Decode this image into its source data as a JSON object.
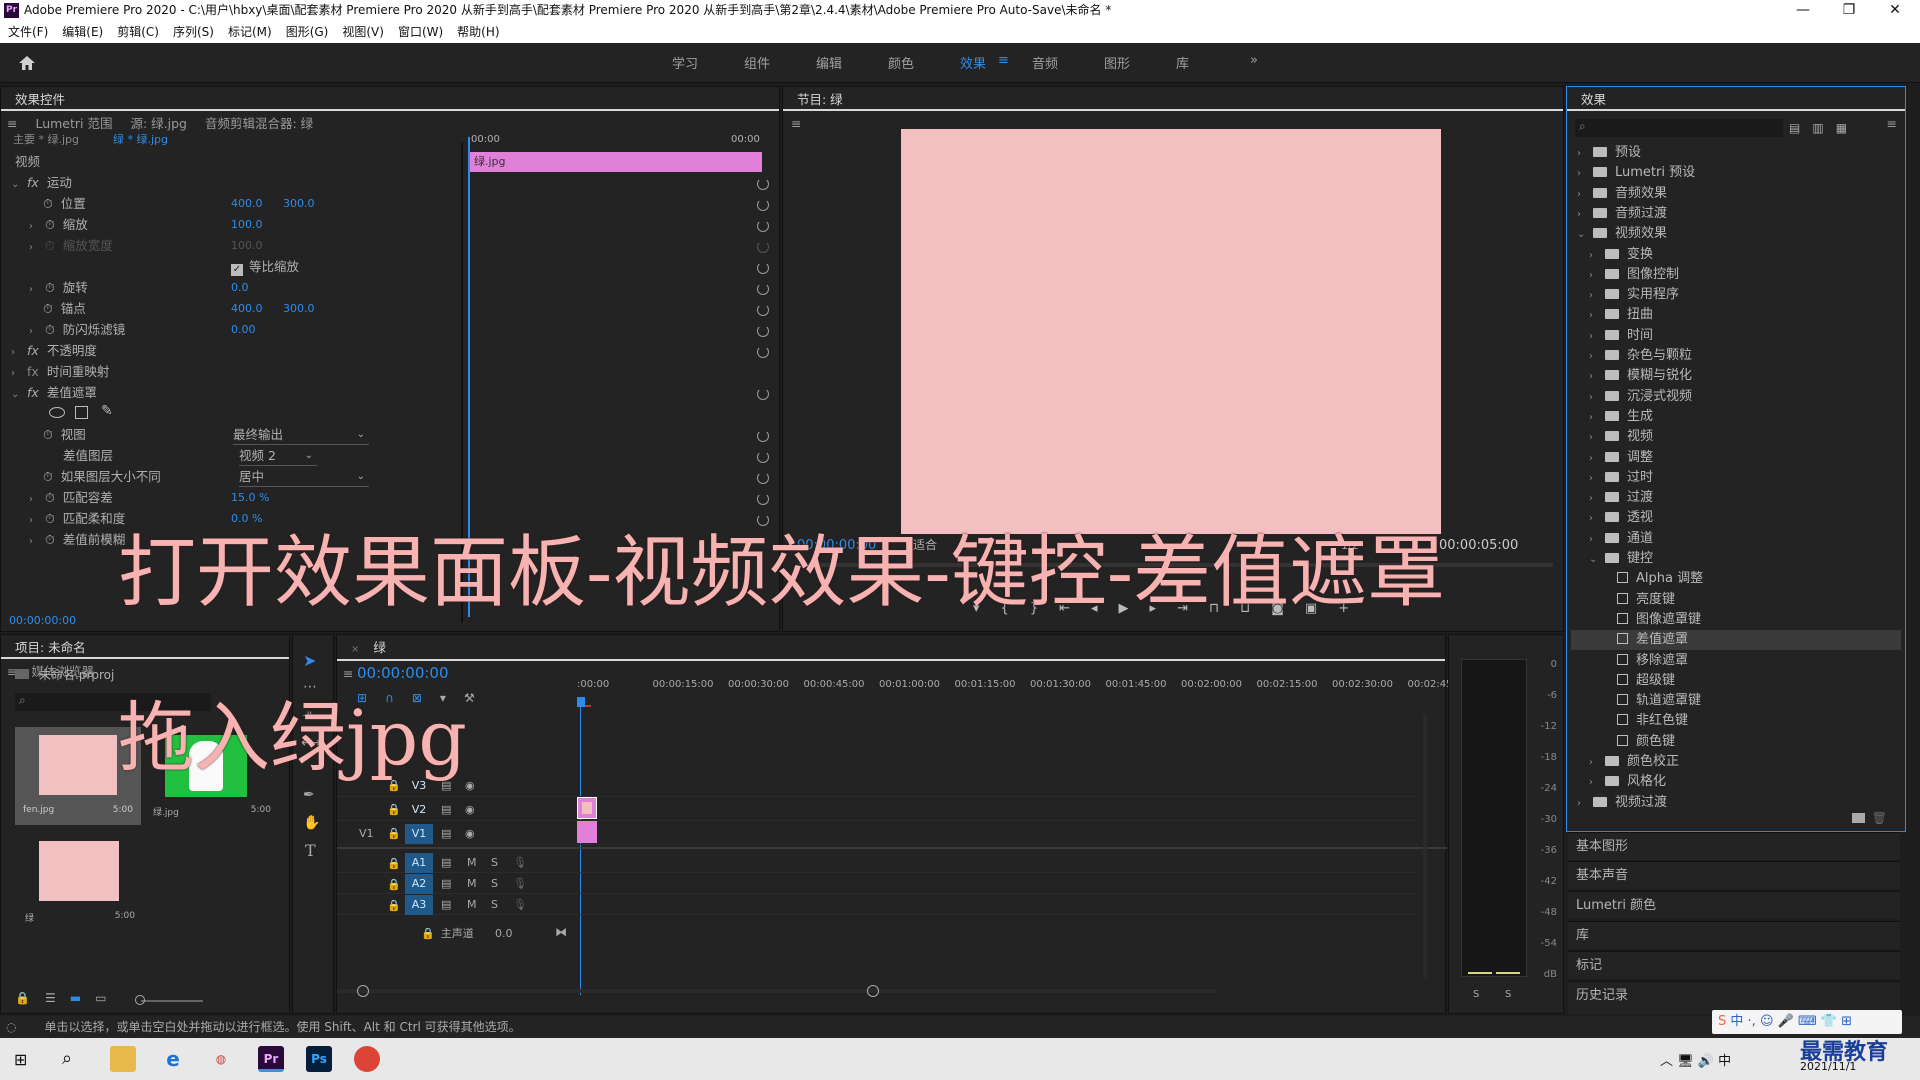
{
  "window": {
    "title": "Adobe Premiere Pro 2020 - C:\\用户\\hbxy\\桌面\\配套素材 Premiere Pro 2020 从新手到高手\\配套素材 Premiere Pro 2020 从新手到高手\\第2章\\2.4.4\\素材\\Adobe Premiere Pro Auto-Save\\未命名 *",
    "app_icon": "Pr",
    "controls": [
      "—",
      "❐",
      "✕"
    ]
  },
  "menu": [
    "文件(F)",
    "编辑(E)",
    "剪辑(C)",
    "序列(S)",
    "标记(M)",
    "图形(G)",
    "视图(V)",
    "窗口(W)",
    "帮助(H)"
  ],
  "workspaces": {
    "home_icon": "home-icon",
    "items": [
      "学习",
      "组件",
      "编辑",
      "颜色",
      "效果",
      "音频",
      "图形",
      "库"
    ],
    "active": "效果",
    "more": "»"
  },
  "effect_controls": {
    "tabs": [
      "效果控件",
      "Lumetri 范围",
      "源: 绿.jpg",
      "音频剪辑混合器: 绿"
    ],
    "master": "主要 * 绿.jpg",
    "clip": "绿 * 绿.jpg",
    "time_start": "00:00",
    "time_end": "00:00",
    "clip_label": "绿.jpg",
    "section": "视频",
    "motion": "运动",
    "position_label": "位置",
    "position_x": "400.0",
    "position_y": "300.0",
    "scale_label": "缩放",
    "scale_value": "100.0",
    "scale_width_label": "缩放宽度",
    "scale_width_value": "100.0",
    "uniform_label": "等比缩放",
    "rotation_label": "旋转",
    "rotation_value": "0.0",
    "anchor_label": "锚点",
    "anchor_x": "400.0",
    "anchor_y": "300.0",
    "antiflicker_label": "防闪烁滤镜",
    "antiflicker_value": "0.00",
    "opacity": "不透明度",
    "time_remap": "时间重映射",
    "diff_matte": "差值遮罩",
    "view_label": "视图",
    "view_value": "最终输出",
    "diff_layer_label": "差值图层",
    "diff_layer_value": "视频 2",
    "if_size_label": "如果图层大小不同",
    "if_size_value": "居中",
    "match_tol_label": "匹配容差",
    "match_tol_value": "15.0 %",
    "match_soft_label": "匹配柔和度",
    "match_soft_value": "0.0 %",
    "blur_label": "差值前模糊",
    "timecode": "00:00:00:00"
  },
  "program": {
    "title": "节目: 绿",
    "timecode": "00:00:00:00",
    "fit": "适合",
    "fraction": "1/2",
    "duration": "00:00:05:00",
    "frame_color": "#f3c0c2"
  },
  "effects_panel": {
    "title": "效果",
    "search_placeholder": "",
    "items": [
      {
        "label": "预设",
        "level": 0,
        "type": "folder",
        "open": false
      },
      {
        "label": "Lumetri 预设",
        "level": 0,
        "type": "folder",
        "open": false
      },
      {
        "label": "音频效果",
        "level": 0,
        "type": "folder",
        "open": false
      },
      {
        "label": "音频过渡",
        "level": 0,
        "type": "folder",
        "open": false
      },
      {
        "label": "视频效果",
        "level": 0,
        "type": "folder",
        "open": true
      },
      {
        "label": "变换",
        "level": 1,
        "type": "folder",
        "open": false
      },
      {
        "label": "图像控制",
        "level": 1,
        "type": "folder",
        "open": false
      },
      {
        "label": "实用程序",
        "level": 1,
        "type": "folder",
        "open": false
      },
      {
        "label": "扭曲",
        "level": 1,
        "type": "folder",
        "open": false
      },
      {
        "label": "时间",
        "level": 1,
        "type": "folder",
        "open": false
      },
      {
        "label": "杂色与颗粒",
        "level": 1,
        "type": "folder",
        "open": false
      },
      {
        "label": "模糊与锐化",
        "level": 1,
        "type": "folder",
        "open": false
      },
      {
        "label": "沉浸式视频",
        "level": 1,
        "type": "folder",
        "open": false
      },
      {
        "label": "生成",
        "level": 1,
        "type": "folder",
        "open": false
      },
      {
        "label": "视频",
        "level": 1,
        "type": "folder",
        "open": false
      },
      {
        "label": "调整",
        "level": 1,
        "type": "folder",
        "open": false
      },
      {
        "label": "过时",
        "level": 1,
        "type": "folder",
        "open": false
      },
      {
        "label": "过渡",
        "level": 1,
        "type": "folder",
        "open": false
      },
      {
        "label": "透视",
        "level": 1,
        "type": "folder",
        "open": false
      },
      {
        "label": "通道",
        "level": 1,
        "type": "folder",
        "open": false
      },
      {
        "label": "键控",
        "level": 1,
        "type": "folder",
        "open": true
      },
      {
        "label": "Alpha 调整",
        "level": 2,
        "type": "effect"
      },
      {
        "label": "亮度键",
        "level": 2,
        "type": "effect"
      },
      {
        "label": "图像遮罩键",
        "level": 2,
        "type": "effect"
      },
      {
        "label": "差值遮罩",
        "level": 2,
        "type": "effect",
        "selected": true
      },
      {
        "label": "移除遮罩",
        "level": 2,
        "type": "effect"
      },
      {
        "label": "超级键",
        "level": 2,
        "type": "effect"
      },
      {
        "label": "轨道遮罩键",
        "level": 2,
        "type": "effect"
      },
      {
        "label": "非红色键",
        "level": 2,
        "type": "effect"
      },
      {
        "label": "颜色键",
        "level": 2,
        "type": "effect"
      },
      {
        "label": "颜色校正",
        "level": 1,
        "type": "folder",
        "open": false
      },
      {
        "label": "风格化",
        "level": 1,
        "type": "folder",
        "open": false
      },
      {
        "label": "视频过渡",
        "level": 0,
        "type": "folder",
        "open": false
      }
    ]
  },
  "side_panels": [
    "基本图形",
    "基本声音",
    "Lumetri 颜色",
    "库",
    "标记",
    "历史记录"
  ],
  "project": {
    "tabs": [
      "项目: 未命名",
      "媒体浏览器"
    ],
    "file": "未命名.prproj",
    "items": [
      {
        "name": "fen.jpg",
        "duration": "5:00"
      },
      {
        "name": "绿.jpg",
        "duration": "5:00"
      },
      {
        "name": "绿",
        "duration": "5:00"
      }
    ]
  },
  "timeline": {
    "tab": "绿",
    "timecode": "00:00:00:00",
    "ruler": [
      ":00:00",
      "00:00:15:00",
      "00:00:30:00",
      "00:00:45:00",
      "00:01:00:00",
      "00:01:15:00",
      "00:01:30:00",
      "00:01:45:00",
      "00:02:00:00",
      "00:02:15:00",
      "00:02:30:00",
      "00:02:45:"
    ],
    "video_tracks": [
      "V3",
      "V2",
      "V1"
    ],
    "source_track": "V1",
    "audio_tracks": [
      "A1",
      "A2",
      "A3"
    ],
    "master_label": "主声道",
    "master_value": "0.0",
    "mute": "M",
    "solo": "S"
  },
  "meter": {
    "scale": [
      "0",
      "-6",
      "-12",
      "-18",
      "-24",
      "-30",
      "-36",
      "-42",
      "-48",
      "-54",
      "dB"
    ],
    "solo": [
      "S",
      "S"
    ]
  },
  "status": "单击以选择，或单击空白处并拖动以进行框选。使用 Shift、Alt 和 Ctrl 可获得其他选项。",
  "overlay": {
    "line1": "打开效果面板-视频效果-键控-差值遮罩",
    "line2": "拖入绿jpg"
  },
  "taskbar": {
    "date": "2021/11/1",
    "watermark": "最需教育",
    "ime": "中"
  }
}
